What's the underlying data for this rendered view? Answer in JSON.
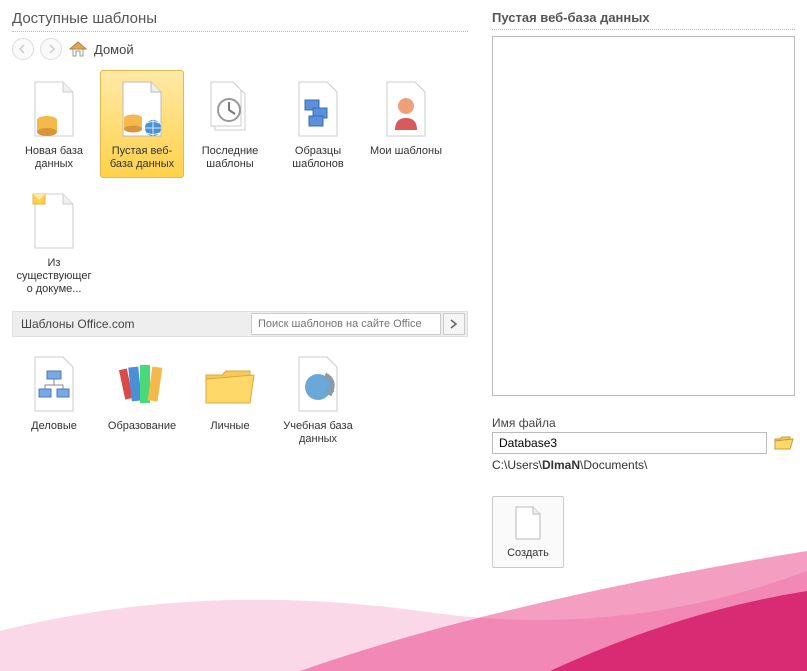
{
  "left": {
    "title": "Доступные шаблоны",
    "breadcrumb_home": "Домой",
    "templates_row1": [
      {
        "label": "Новая база данных"
      },
      {
        "label": "Пустая веб-база данных"
      },
      {
        "label": "Последние шаблоны"
      },
      {
        "label": "Образцы шаблонов"
      },
      {
        "label": "Мои шаблоны"
      }
    ],
    "templates_row2": [
      {
        "label": "Из существующего докуме..."
      }
    ],
    "office_label": "Шаблоны Office.com",
    "office_search_placeholder": "Поиск шаблонов на сайте Office",
    "categories": [
      {
        "label": "Деловые"
      },
      {
        "label": "Образование"
      },
      {
        "label": "Личные"
      },
      {
        "label": "Учебная база данных"
      }
    ]
  },
  "right": {
    "title": "Пустая веб-база данных",
    "file_label": "Имя файла",
    "file_value": "Database3",
    "path_prefix": "C:\\Users\\",
    "path_user": "DImaN",
    "path_suffix": "\\Documents\\",
    "create_label": "Создать"
  }
}
